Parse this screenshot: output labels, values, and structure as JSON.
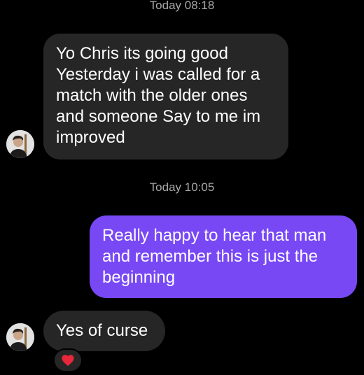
{
  "messages": [
    {
      "timestamp": "Today 08:18",
      "from": "received",
      "lines": [
        "Yo Chris its going good",
        "Yesterday i was called for a",
        "match with the older ones",
        "and someone Say to me im",
        "improved"
      ]
    },
    {
      "timestamp": "Today 10:05",
      "from": "sent",
      "lines": [
        "Really happy to hear that man",
        "and remember this is just the",
        "beginning"
      ]
    },
    {
      "from": "received",
      "lines": [
        "Yes of curse"
      ],
      "reaction": "heart-icon"
    }
  ],
  "colors": {
    "background": "#000000",
    "received_bubble": "#262626",
    "sent_bubble": "#7848f5",
    "timestamp_text": "#a8a8a8",
    "message_text": "#ffffff",
    "reaction_heart": "#e8273b"
  },
  "icons": {
    "avatar": "contact-avatar-photo",
    "reaction": "heart-icon"
  }
}
